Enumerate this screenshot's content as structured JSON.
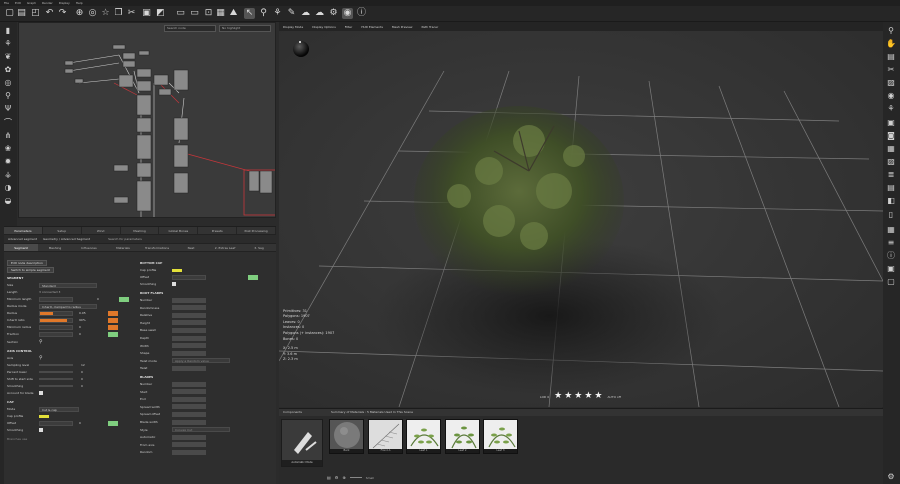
{
  "menu": [
    "File",
    "Edit",
    "Graph",
    "Render",
    "Display",
    "Help"
  ],
  "graph_panel": {
    "search_placeholder": "Search node",
    "highlight_label": "No highlight"
  },
  "params": {
    "tabs": [
      "Parameters",
      "Setup",
      "Wind",
      "Meshing",
      "Global Bones",
      "Presets",
      "Post Processing"
    ],
    "active_tab": 0,
    "row2": [
      "Advanced segment",
      "Geometry / Advanced Segment",
      "Search for parameters"
    ],
    "subtabs": [
      "Segment",
      "Meshing",
      "Influences",
      "Materials",
      "Transformations",
      "Nest",
      "2. Extras Leaf",
      "3. Sag"
    ],
    "active_subtab": 0,
    "left": {
      "buttons": [
        "Edit node description",
        "Switch to simple segment"
      ],
      "segment_header": "SEGMENT",
      "size_label": "Size",
      "size_value": "Standard",
      "length_label": "Length",
      "length_value": "3 connected 3",
      "min_length_label": "Minimum length",
      "min_length_value": "0",
      "radius_mode_label": "Radius mode",
      "radius_mode_value": "Inherit, clamped to radius",
      "radius_label": "Radius",
      "radius_value": "0.05",
      "inherit_label": "Inherit ratio",
      "inherit_value": "90%",
      "min_radius_label": "Minimum radius",
      "min_radius_value": "0",
      "fraction_label": "Fraction",
      "fraction_value": "0",
      "section_label": "Section",
      "axis_header": "AXIS CONTROL",
      "axis_label": "Axis",
      "sampling_label": "Sampling level",
      "sampling_value": "12",
      "percent_label": "Percent basic",
      "percent_value": "0",
      "shift_label": "Shift to start side",
      "shift_value": "0",
      "smoothing_label": "Smoothing",
      "smoothing_value": "0",
      "account_label": "Account for blade",
      "cap_header": "CAP",
      "mode_label": "Mode",
      "mode_value": "Cut & cap",
      "cap_profile_label": "Cap profile",
      "offset_label": "Offset",
      "offset_value": "0",
      "cap_smoothing_label": "Smoothing",
      "footer_label": "Branches use"
    },
    "right": {
      "bottom_cap_header": "BOTTOM CAP",
      "cap_profile_label": "Cap profile",
      "offset_label": "Offset",
      "smoothing_label": "Smoothing",
      "root_flares_header": "ROOT FLARES",
      "flare_labels": [
        "Number",
        "Randomness",
        "Relative",
        "Height",
        "Base swell",
        "Depth",
        "Width",
        "Shape",
        "Twist mode",
        "Twist"
      ],
      "twist_mode_value": "Apply a Random value",
      "blades_header": "BLADES",
      "blade_labels": [
        "Number",
        "Start",
        "End",
        "Spread width",
        "Spread offset",
        "Blade width",
        "Style",
        "Automatic",
        "From axis",
        "Random"
      ],
      "style_value": "Convex Cut"
    }
  },
  "viewport": {
    "tabs": [
      "Display Mode",
      "Display Options",
      "Filter",
      "HUD Elements",
      "Mesh Preview",
      "Path Tracer"
    ],
    "stats": [
      "Primitives: 31",
      "Polygons: 1907",
      "Leaves: 0",
      "Instances: 0",
      "Polygons (+ instances): 1907",
      "Bones: 0",
      "X: 2.5 m",
      "Y: 3.6 m",
      "Z: 2.3 m"
    ],
    "lod_label": "LOD 0",
    "auto_label": "AUTO off",
    "stars": 5
  },
  "materials": {
    "components_label": "Components",
    "summary_label": "Summary of Materials : 5 Materials Used In This Scene",
    "thumbs": [
      "Bark",
      "Frond A",
      "Leaf 1",
      "Leaf 2",
      "Leaf 3"
    ],
    "automatic_mode_label": "Automatic Mode",
    "zoom_label": "Small"
  },
  "colors": {
    "accent_green": "#7fce7f",
    "accent_orange": "#e0782a",
    "accent_yellow": "#e3e03a",
    "node_red": "#c8363a",
    "pink": "#ff6bd6",
    "blue": "#5aa7ff"
  }
}
